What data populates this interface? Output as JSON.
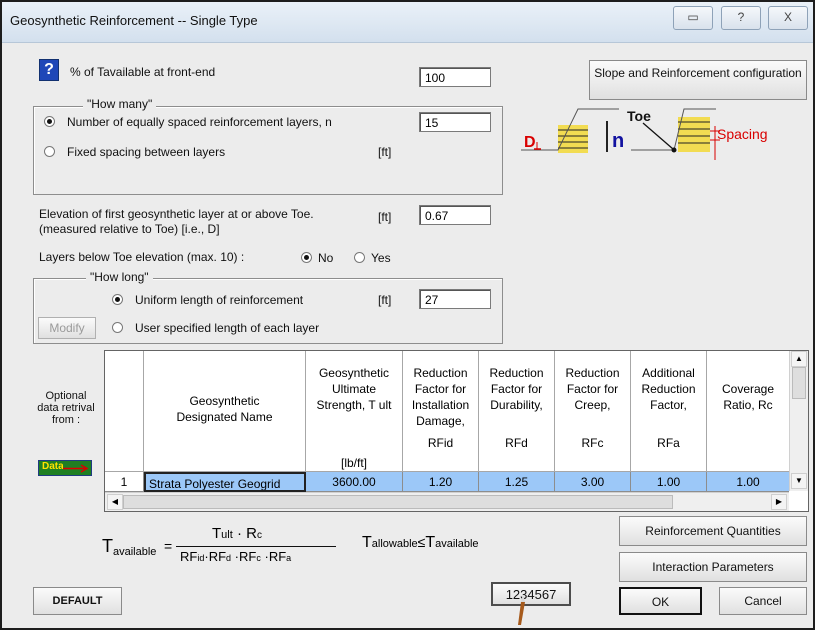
{
  "window": {
    "title": "Geosynthetic Reinforcement -- Single Type",
    "buttons": {
      "restore": "▭",
      "help": "?",
      "close": "X"
    }
  },
  "header": {
    "tavailable_label": "% of Tavailable  at front-end",
    "tavailable_value": "100",
    "slope_button": "Slope and Reinforcement configuration"
  },
  "how_many": {
    "title": "\"How many\"",
    "option1": "Number of equally spaced reinforcement layers,  n",
    "option1_value": "15",
    "option2": "Fixed spacing between layers",
    "option2_unit": "[ft]",
    "selected": "option1"
  },
  "elevation": {
    "line1": "Elevation of first geosynthetic layer at or above Toe.",
    "line2": "(measured relative to Toe)  [i.e.,  D]",
    "unit": "[ft]",
    "value": "0.67"
  },
  "layers_below": {
    "label": "Layers below Toe elevation (max. 10) :",
    "no": "No",
    "yes": "Yes",
    "selected": "No"
  },
  "how_long": {
    "title": "\"How long\"",
    "option1": "Uniform length of reinforcement",
    "unit": "[ft]",
    "value": "27",
    "option2": "User specified length of each layer",
    "modify_button": "Modify"
  },
  "diagram": {
    "toe": "Toe",
    "spacing": "Spacing",
    "d": "D",
    "n": "n",
    "colors": {
      "layers": "#f2dc52",
      "red": "#d90000",
      "blue": "#1212a0"
    }
  },
  "optional": {
    "label": "Optional data retrival from :",
    "data_button": "Data"
  },
  "table": {
    "columns": [
      {
        "title": "Geosynthetic Designated Name",
        "unit": ""
      },
      {
        "title": "Geosynthetic Ultimate Strength, T ult",
        "unit": "[lb/ft]"
      },
      {
        "title": "Reduction Factor for Installation Damage,",
        "unit": "RFid"
      },
      {
        "title": "Reduction Factor for Durability,",
        "unit": "RFd"
      },
      {
        "title": "Reduction Factor for Creep,",
        "unit": "RFc"
      },
      {
        "title": "Additional Reduction Factor,",
        "unit": "RFa"
      },
      {
        "title": "Coverage Ratio, Rc",
        "unit": ""
      }
    ],
    "rows": [
      [
        "1",
        "Strata Polyester Geogrid",
        "3600.00",
        "1.20",
        "1.25",
        "3.00",
        "1.00",
        "1.00"
      ]
    ],
    "selection_color": "#9cc8f8"
  },
  "formula": {
    "lhs_main": "T",
    "lhs_sub": "available",
    "num_main": "T",
    "num_sub": "ult",
    "num_rest": "· R",
    "num_sub2": "c",
    "den": "RF",
    "den_sub1": "id",
    "den_sub2": "d",
    "den_sub3": "c",
    "den_sub4": "a",
    "allowable_main": "T",
    "allowable_sub": "allowable",
    "le": "≤",
    "available_main": "T",
    "available_sub": "available"
  },
  "buttons": {
    "reinforcement_quantities": "Reinforcement Quantities",
    "interaction_parameters": "Interaction Parameters",
    "ok": "OK",
    "cancel": "Cancel",
    "default": "DEFAULT",
    "numeric": "1234567"
  }
}
